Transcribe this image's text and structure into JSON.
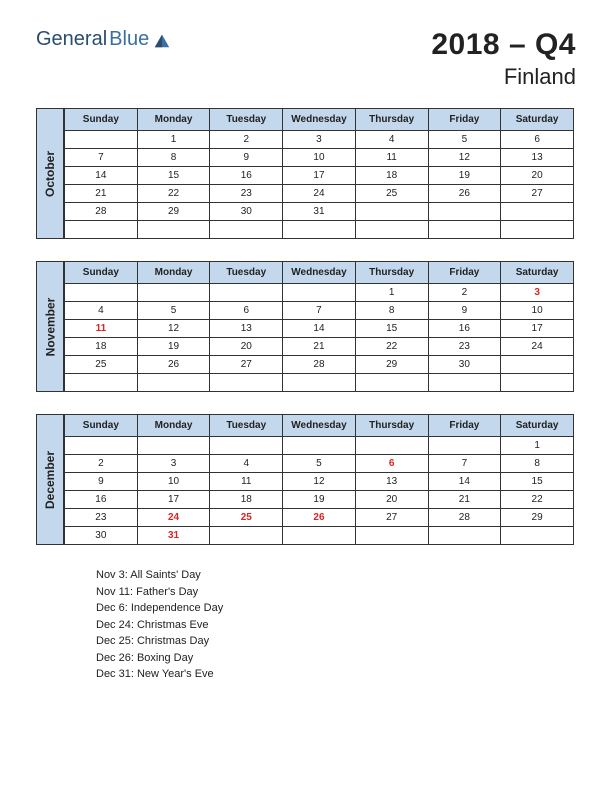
{
  "logo": {
    "text1": "General",
    "text2": "Blue"
  },
  "title": {
    "period": "2018 – Q4",
    "country": "Finland"
  },
  "days": [
    "Sunday",
    "Monday",
    "Tuesday",
    "Wednesday",
    "Thursday",
    "Friday",
    "Saturday"
  ],
  "months": [
    {
      "name": "October",
      "weeks": [
        [
          "",
          "1",
          "2",
          "3",
          "4",
          "5",
          "6"
        ],
        [
          "7",
          "8",
          "9",
          "10",
          "11",
          "12",
          "13"
        ],
        [
          "14",
          "15",
          "16",
          "17",
          "18",
          "19",
          "20"
        ],
        [
          "21",
          "22",
          "23",
          "24",
          "25",
          "26",
          "27"
        ],
        [
          "28",
          "29",
          "30",
          "31",
          "",
          "",
          ""
        ],
        [
          "",
          "",
          "",
          "",
          "",
          "",
          ""
        ]
      ],
      "holidays": []
    },
    {
      "name": "November",
      "weeks": [
        [
          "",
          "",
          "",
          "",
          "1",
          "2",
          "3"
        ],
        [
          "4",
          "5",
          "6",
          "7",
          "8",
          "9",
          "10"
        ],
        [
          "11",
          "12",
          "13",
          "14",
          "15",
          "16",
          "17"
        ],
        [
          "18",
          "19",
          "20",
          "21",
          "22",
          "23",
          "24"
        ],
        [
          "25",
          "26",
          "27",
          "28",
          "29",
          "30",
          ""
        ],
        [
          "",
          "",
          "",
          "",
          "",
          "",
          ""
        ]
      ],
      "holidays": [
        "3",
        "11"
      ]
    },
    {
      "name": "December",
      "weeks": [
        [
          "",
          "",
          "",
          "",
          "",
          "",
          "1"
        ],
        [
          "2",
          "3",
          "4",
          "5",
          "6",
          "7",
          "8"
        ],
        [
          "9",
          "10",
          "11",
          "12",
          "13",
          "14",
          "15"
        ],
        [
          "16",
          "17",
          "18",
          "19",
          "20",
          "21",
          "22"
        ],
        [
          "23",
          "24",
          "25",
          "26",
          "27",
          "28",
          "29"
        ],
        [
          "30",
          "31",
          "",
          "",
          "",
          "",
          ""
        ]
      ],
      "holidays": [
        "6",
        "24",
        "25",
        "26",
        "31"
      ]
    }
  ],
  "holiday_list": [
    "Nov 3: All Saints' Day",
    "Nov 11: Father's Day",
    "Dec 6: Independence Day",
    "Dec 24: Christmas Eve",
    "Dec 25: Christmas Day",
    "Dec 26: Boxing Day",
    "Dec 31: New Year's Eve"
  ]
}
